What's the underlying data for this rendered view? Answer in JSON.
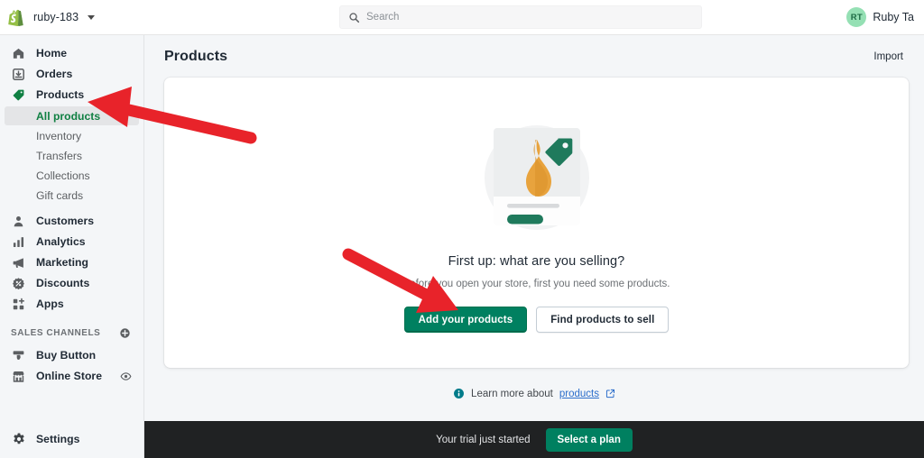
{
  "topbar": {
    "logo_icon": "shopify-bag-logo",
    "store_name": "ruby-183",
    "store_caret_icon": "chevron-down-icon",
    "search": {
      "icon": "search-icon",
      "placeholder": "Search",
      "value": ""
    },
    "user": {
      "avatar_initials": "RT",
      "name": "Ruby Ta"
    }
  },
  "sidebar": {
    "items": [
      {
        "label": "Home",
        "icon": "home-icon"
      },
      {
        "label": "Orders",
        "icon": "orders-inbox-icon"
      },
      {
        "label": "Products",
        "icon": "products-tag-icon",
        "active_parent": true
      }
    ],
    "product_subitems": [
      {
        "label": "All products",
        "active": true
      },
      {
        "label": "Inventory",
        "active": false
      },
      {
        "label": "Transfers",
        "active": false
      },
      {
        "label": "Collections",
        "active": false
      },
      {
        "label": "Gift cards",
        "active": false
      }
    ],
    "items_lower": [
      {
        "label": "Customers",
        "icon": "person-icon"
      },
      {
        "label": "Analytics",
        "icon": "bar-chart-icon"
      },
      {
        "label": "Marketing",
        "icon": "megaphone-icon"
      },
      {
        "label": "Discounts",
        "icon": "discount-percent-icon"
      },
      {
        "label": "Apps",
        "icon": "apps-grid-plus-icon"
      }
    ],
    "sales_channels": {
      "title": "SALES CHANNELS",
      "add_icon": "plus-circle-icon",
      "items": [
        {
          "label": "Buy Button",
          "icon": "buy-button-icon",
          "trailing_icon": ""
        },
        {
          "label": "Online Store",
          "icon": "storefront-icon",
          "trailing_icon": "eye-icon"
        }
      ]
    },
    "settings": {
      "label": "Settings",
      "icon": "gear-icon"
    }
  },
  "main": {
    "page_title": "Products",
    "import_label": "Import",
    "empty_state": {
      "illustration": "product-card-vase-illustration",
      "title": "First up: what are you selling?",
      "subtitle": "Before you open your store, first you need some products.",
      "primary_button": "Add your products",
      "secondary_button": "Find products to sell"
    },
    "learn_more": {
      "icon": "info-circle-icon",
      "text": "Learn more about",
      "link_label": "products",
      "external_icon": "external-link-icon"
    }
  },
  "banner": {
    "text": "Your trial just started",
    "button_label": "Select a plan"
  },
  "annotations": [
    {
      "name": "arrow-to-all-products",
      "color": "#e8232a"
    },
    {
      "name": "arrow-to-add-products",
      "color": "#e8232a"
    }
  ],
  "colors": {
    "brand_green": "#008060",
    "accent_green": "#108043",
    "page_bg": "#f4f6f8",
    "banner_bg": "#202223",
    "link_blue": "#2c6ecb",
    "annotation_red": "#e8232a"
  }
}
